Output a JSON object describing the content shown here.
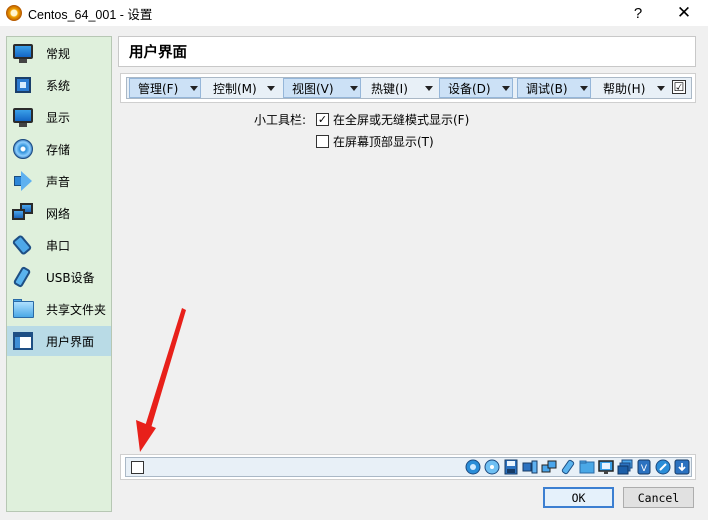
{
  "window": {
    "title": "Centos_64_001 - 设置",
    "help_button": "?",
    "close_button": "✕"
  },
  "sidebar": {
    "items": [
      {
        "label": "常规",
        "icon": "monitor-icon"
      },
      {
        "label": "系统",
        "icon": "chip-icon"
      },
      {
        "label": "显示",
        "icon": "display-icon"
      },
      {
        "label": "存储",
        "icon": "disk-icon"
      },
      {
        "label": "声音",
        "icon": "speaker-icon"
      },
      {
        "label": "网络",
        "icon": "network-icon"
      },
      {
        "label": "串口",
        "icon": "serial-port-icon"
      },
      {
        "label": "USB设备",
        "icon": "usb-icon"
      },
      {
        "label": "共享文件夹",
        "icon": "folder-icon"
      },
      {
        "label": "用户界面",
        "icon": "window-icon",
        "selected": true
      }
    ]
  },
  "page": {
    "title": "用户界面"
  },
  "menubar": {
    "items": [
      {
        "label": "管理(F)",
        "checked": true
      },
      {
        "label": "控制(M)",
        "checked": false
      },
      {
        "label": "视图(V)",
        "checked": true
      },
      {
        "label": "热键(I)",
        "checked": false
      },
      {
        "label": "设备(D)",
        "checked": true
      },
      {
        "label": "调试(B)",
        "checked": true
      },
      {
        "label": "帮助(H)",
        "checked": false
      }
    ],
    "enabled_check": "☑"
  },
  "mini_toolbar": {
    "label": "小工具栏:",
    "options": [
      {
        "label": "在全屏或无缝模式显示(F)",
        "checked": true,
        "mark": "✓"
      },
      {
        "label": "在屏幕顶部显示(T)",
        "checked": false,
        "mark": ""
      }
    ]
  },
  "statusbar": {
    "enabled": false,
    "icons": [
      "hard-disk-icon",
      "optical-disk-icon",
      "floppy-icon",
      "audio-icon",
      "network-icon",
      "usb-icon",
      "shared-folder-icon",
      "display-icon",
      "recording-icon",
      "video-capture-icon",
      "mouse-icon",
      "keyboard-icon"
    ]
  },
  "buttons": {
    "ok": "OK",
    "cancel": "Cancel"
  },
  "colors": {
    "sidebar_bg": "#dff0dc",
    "selected_bg": "#b9dbe6",
    "arrow_red": "#e8201a",
    "menubar_bg": "#e8f0f7"
  }
}
